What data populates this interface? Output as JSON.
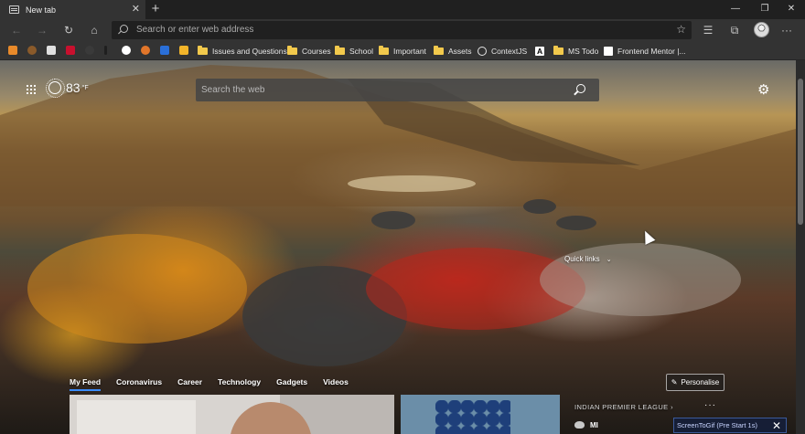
{
  "tab": {
    "title": "New tab",
    "close_glyph": "✕",
    "favicon": "newtab-icon"
  },
  "window": {
    "minimize": "—",
    "restore": "❐",
    "close": "✕",
    "new_tab": "+"
  },
  "toolbar": {
    "back": "←",
    "forward": "→",
    "refresh": "↻",
    "home": "⌂",
    "address_placeholder": "Search or enter web address",
    "favorite": "☆",
    "favorites_list": "☰",
    "collections": "⧉",
    "menu": "···"
  },
  "bookmarks": {
    "folders": [
      {
        "label": "Issues and Questions"
      },
      {
        "label": "Courses"
      },
      {
        "label": "School"
      },
      {
        "label": "Important"
      },
      {
        "label": "Assets"
      }
    ],
    "links": [
      {
        "label": "ContextJS"
      },
      {
        "label": "A"
      },
      {
        "label": "MS Todo"
      },
      {
        "label": "Frontend Mentor |..."
      }
    ],
    "icon_colors": [
      "#e98a2a",
      "#8a5a2a",
      "#e0e0e0",
      "#c8102e",
      "#3a3a3a",
      "#1f1f1f",
      "#ffffff",
      "#e2762a",
      "#2a6fd8",
      "#f3b52a"
    ]
  },
  "ntp": {
    "weather": {
      "temperature": "83",
      "unit": "°F"
    },
    "search": {
      "placeholder": "Search the web"
    },
    "quick_links": {
      "label": "Quick links",
      "chevron": "⌄"
    },
    "feed_tabs": [
      "My Feed",
      "Coronavirus",
      "Career",
      "Technology",
      "Gadgets",
      "Videos"
    ],
    "personalise": "Personalise",
    "league": {
      "label": "INDIAN PREMIER LEAGUE",
      "chevron": "›",
      "team": "MI",
      "more": "···"
    }
  },
  "overlay": {
    "label": "ScreenToGif (Pre Start 1s)",
    "close": "✕"
  },
  "colors": {
    "chrome": "#333333",
    "titlebar": "#202020",
    "accent": "#3a8cff"
  }
}
